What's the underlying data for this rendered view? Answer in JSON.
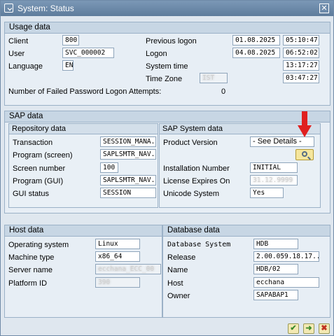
{
  "window": {
    "title": "System: Status",
    "close_label": "✕"
  },
  "usage": {
    "header": "Usage data",
    "client_label": "Client",
    "client_value": "800",
    "user_label": "User",
    "user_value": "SVC_000002",
    "language_label": "Language",
    "language_value": "EN",
    "prev_logon_label": "Previous logon",
    "prev_logon_date": "01.08.2025",
    "prev_logon_time": "05:10:47",
    "logon_label": "Logon",
    "logon_date": "04.08.2025",
    "logon_time": "06:52:02",
    "system_time_label": "System time",
    "system_time_value": "13:17:27",
    "time_zone_label": "Time Zone",
    "time_zone_value": "IST",
    "time_zone_time": "03:47:27",
    "failed_label": "Number of Failed Password Logon Attempts:",
    "failed_value": "0"
  },
  "sap": {
    "header": "SAP data",
    "repo_header": "Repository data",
    "transaction_label": "Transaction",
    "transaction_value": "SESSION_MANA...",
    "program_screen_label": "Program (screen)",
    "program_screen_value": "SAPLSMTR_NAV...",
    "screen_number_label": "Screen number",
    "screen_number_value": "100",
    "program_gui_label": "Program (GUI)",
    "program_gui_value": "SAPLSMTR_NAV...",
    "gui_status_label": "GUI status",
    "gui_status_value": "SESSION",
    "system_header": "SAP System data",
    "product_version_label": "Product Version",
    "product_version_value": "- See Details -",
    "installation_label": "Installation Number",
    "installation_value": "INITIAL",
    "license_label": "License Expires On",
    "license_value": "31.12.9999",
    "unicode_label": "Unicode System",
    "unicode_value": "Yes"
  },
  "host": {
    "header": "Host data",
    "os_label": "Operating system",
    "os_value": "Linux",
    "machine_label": "Machine type",
    "machine_value": "x86_64",
    "server_label": "Server name",
    "server_value": "ecchana_ECC_00",
    "platform_label": "Platform ID",
    "platform_value": "390"
  },
  "db": {
    "header": "Database data",
    "system_label": "Database System",
    "system_value": "HDB",
    "release_label": "Release",
    "release_value": "2.00.059.18.17...",
    "name_label": "Name",
    "name_value": "HDB/02",
    "host_label": "Host",
    "host_value": "ecchana",
    "owner_label": "Owner",
    "owner_value": "SAPABAP1"
  },
  "footer": {
    "ok_label": "✔",
    "next_label": "➜",
    "cancel_label": "✖"
  },
  "colors": {
    "arrow": "#e02020",
    "cancel": "#c03020",
    "ok": "#3a8a2a"
  }
}
